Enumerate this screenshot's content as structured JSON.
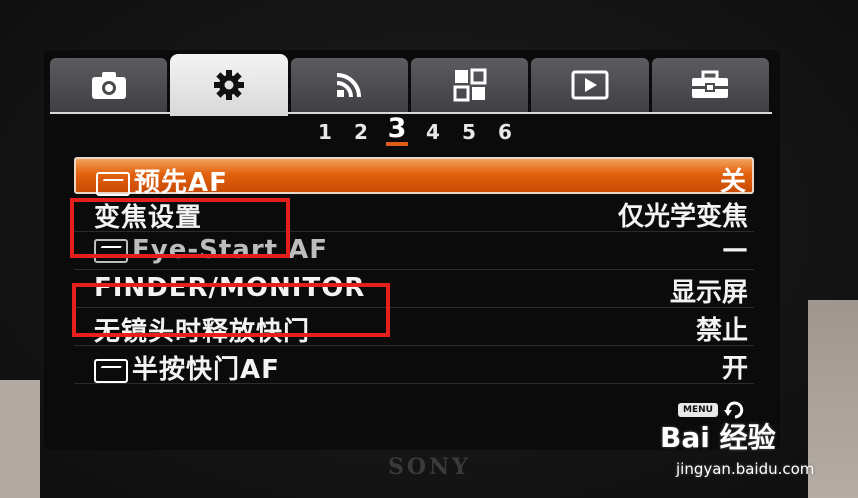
{
  "tabs": [
    {
      "icon": "camera-icon"
    },
    {
      "icon": "gear-icon",
      "active": true
    },
    {
      "icon": "wireless-icon"
    },
    {
      "icon": "grid-icon"
    },
    {
      "icon": "playback-icon"
    },
    {
      "icon": "toolbox-icon"
    }
  ],
  "pages": {
    "p1": "1",
    "p2": "2",
    "p3": "3",
    "p4": "4",
    "p5": "5",
    "p6": "6"
  },
  "menu": {
    "items": [
      {
        "label": "预先AF",
        "value": "关"
      },
      {
        "label": "变焦设置",
        "value": "仅光学变焦"
      },
      {
        "label": "Eye-Start AF",
        "value": "—"
      },
      {
        "label": "FINDER/MONITOR",
        "value": "显示屏"
      },
      {
        "label": "无镜头时释放快门",
        "value": "禁止"
      },
      {
        "label": "半按快门AF",
        "value": "开"
      }
    ]
  },
  "footer": {
    "menu_label": "MENU"
  },
  "brand": "SONY",
  "watermark": {
    "text": "Bai 经验",
    "url": "jingyan.baidu.com"
  },
  "colors": {
    "selected": "#e2620e",
    "highlight_box": "#e5201c"
  }
}
